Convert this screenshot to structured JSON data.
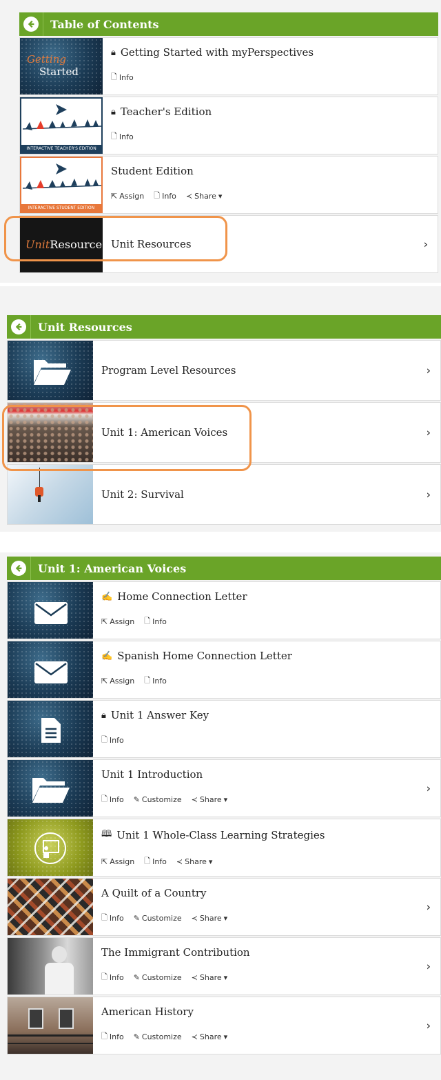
{
  "panel1": {
    "header": "Table of Contents",
    "items": [
      {
        "title": "Getting Started with myPerspectives",
        "locked": true,
        "thumb_text_a": "Getting",
        "thumb_text_b": "Started",
        "actions": [
          "Info"
        ]
      },
      {
        "title": "Teacher's Edition",
        "locked": true,
        "thumb_caption": "INTERACTIVE TEACHER'S EDITION",
        "actions": [
          "Info"
        ]
      },
      {
        "title": "Student Edition",
        "locked": false,
        "thumb_caption": "INTERACTIVE STUDENT EDITION",
        "actions": [
          "Assign",
          "Info",
          "Share"
        ]
      },
      {
        "title": "Unit Resources",
        "thumb_text_a": "Unit",
        "thumb_text_b": "Resources",
        "chevron": "›"
      }
    ]
  },
  "panel2": {
    "header": "Unit Resources",
    "items": [
      {
        "title": "Program Level Resources",
        "chevron": "›"
      },
      {
        "title": "Unit 1: American Voices",
        "chevron": "›"
      },
      {
        "title": "Unit 2: Survival",
        "chevron": "›"
      }
    ]
  },
  "panel3": {
    "header": "Unit 1: American Voices",
    "items": [
      {
        "title": "Home Connection Letter",
        "actions": [
          "Assign",
          "Info"
        ]
      },
      {
        "title": "Spanish Home Connection Letter",
        "actions": [
          "Assign",
          "Info"
        ]
      },
      {
        "title": "Unit 1 Answer Key",
        "actions": [
          "Info"
        ]
      },
      {
        "title": "Unit 1 Introduction",
        "actions": [
          "Info",
          "Customize",
          "Share"
        ],
        "chevron": "›"
      },
      {
        "title": "Unit 1 Whole-Class Learning Strategies",
        "actions": [
          "Assign",
          "Info",
          "Share"
        ]
      },
      {
        "title": "A Quilt of a Country",
        "actions": [
          "Info",
          "Customize",
          "Share"
        ],
        "chevron": "›"
      },
      {
        "title": "The Immigrant Contribution",
        "actions": [
          "Info",
          "Customize",
          "Share"
        ],
        "chevron": "›"
      },
      {
        "title": "American History",
        "actions": [
          "Info",
          "Customize",
          "Share"
        ],
        "chevron": "›"
      }
    ]
  },
  "colors": {
    "header_green": "#6aa428",
    "highlight_orange": "#f0944a"
  }
}
